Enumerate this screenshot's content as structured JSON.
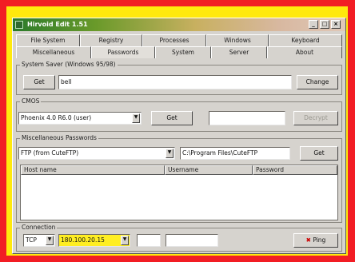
{
  "window": {
    "title": "Hirvoid Edit 1.51"
  },
  "titlebar_buttons": [
    {
      "name": "minimize-button",
      "glyph": "_"
    },
    {
      "name": "maximize-button",
      "glyph": "□"
    },
    {
      "name": "close-button",
      "glyph": "×"
    }
  ],
  "tabs": {
    "row1": [
      "File System",
      "Registry",
      "Processes",
      "Windows",
      "Keyboard"
    ],
    "row2": [
      "Miscellaneous",
      "Passwords",
      "System",
      "Server",
      "About"
    ],
    "active": "Passwords"
  },
  "system_saver": {
    "label": "System Saver (Windows 95/98)",
    "get_label": "Get",
    "value": "bell",
    "change_label": "Change"
  },
  "cmos": {
    "label": "CMOS",
    "selected": "Phoenix 4.0 R6.0 (user)",
    "get_label": "Get",
    "value": "",
    "disabled_button_label": "Decrypt"
  },
  "misc_passwords": {
    "label": "Miscellaneous Passwords",
    "selected": "FTP (from CuteFTP)",
    "path": "C:\\Program Files\\CuteFTP",
    "get_label": "Get",
    "columns": [
      "Host name",
      "Username",
      "Password"
    ]
  },
  "connection": {
    "label": "Connection",
    "protocol": "TCP",
    "ip": "180.100.20.15",
    "port": "",
    "extra": "",
    "ping_label": "Ping"
  }
}
